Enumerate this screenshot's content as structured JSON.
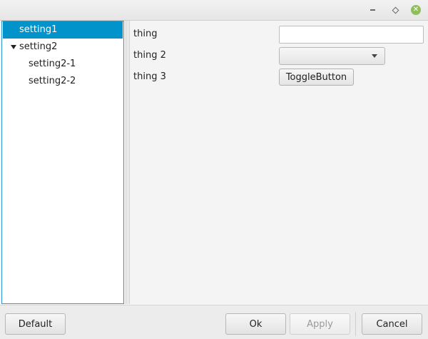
{
  "window": {
    "icons": [
      "minimize-icon",
      "maximize-icon",
      "close-icon"
    ],
    "close_glyph": "✕",
    "accent": "#0293ca"
  },
  "tree": {
    "items": [
      {
        "label": "setting1",
        "selected": true
      },
      {
        "label": "setting2",
        "expanded": true
      },
      {
        "label": "setting2-1"
      },
      {
        "label": "setting2-2"
      }
    ]
  },
  "form": {
    "thing_label": "thing",
    "thing_value": "",
    "thing2_label": "thing 2",
    "thing2_value": "",
    "thing3_label": "thing 3",
    "toggle_label": "ToggleButton"
  },
  "footer": {
    "default_label": "Default",
    "ok_label": "Ok",
    "apply_label": "Apply",
    "cancel_label": "Cancel"
  }
}
